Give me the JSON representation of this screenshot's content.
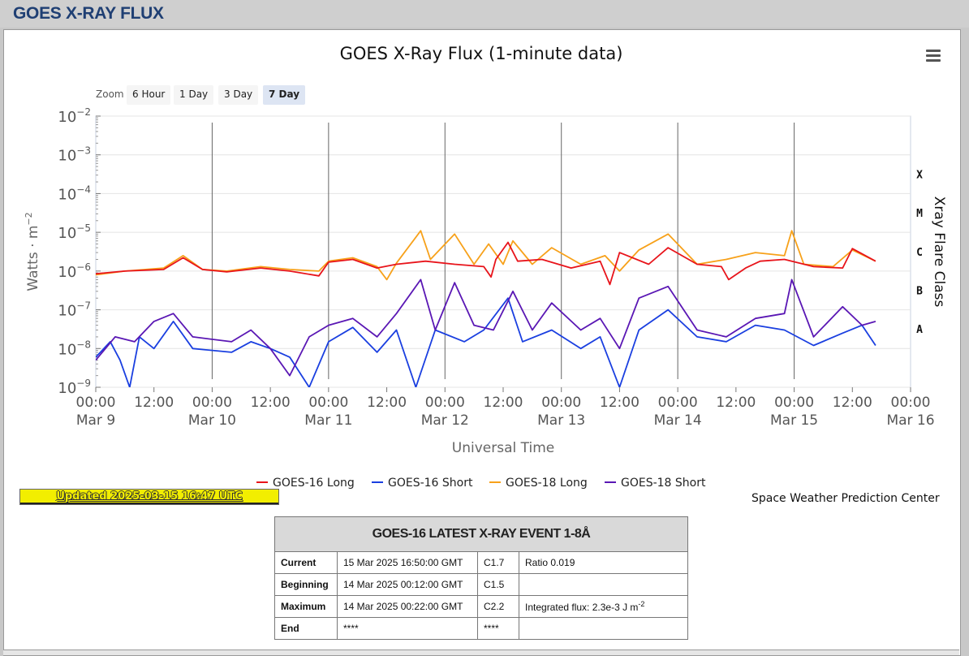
{
  "page": {
    "header_title": "GOES X-RAY FLUX"
  },
  "colors": {
    "goes16_long": "#e8141b",
    "goes16_short": "#1a3fe0",
    "goes18_long": "#f7a11a",
    "goes18_short": "#5a17b4",
    "header_text": "#1f3f73",
    "updated_bg": "#f2ee00"
  },
  "toolbar": {
    "zoom_label": "Zoom",
    "buttons": [
      "6 Hour",
      "1 Day",
      "3 Day",
      "7 Day"
    ],
    "active": "7 Day",
    "menu_icon": "hamburger-menu-icon"
  },
  "chart_data": {
    "type": "line",
    "title": "GOES X-Ray Flux (1-minute data)",
    "xlabel": "Universal Time",
    "ylabel": "Watts · m",
    "ylabel_exponent": "-2",
    "y2label": "Xray Flare Class",
    "y_scale": "log",
    "ylim": [
      1e-09,
      0.01
    ],
    "xlim": [
      "2025-03-09T00:00Z",
      "2025-03-16T00:00Z"
    ],
    "y_ticks": [
      {
        "base": "10",
        "exp": "-2",
        "value": 0.01
      },
      {
        "base": "10",
        "exp": "-3",
        "value": 0.001
      },
      {
        "base": "10",
        "exp": "-4",
        "value": 0.0001
      },
      {
        "base": "10",
        "exp": "-5",
        "value": 1e-05
      },
      {
        "base": "10",
        "exp": "-6",
        "value": 1e-06
      },
      {
        "base": "10",
        "exp": "-7",
        "value": 1e-07
      },
      {
        "base": "10",
        "exp": "-8",
        "value": 1e-08
      },
      {
        "base": "10",
        "exp": "-9",
        "value": 1e-09
      }
    ],
    "flare_classes": [
      {
        "label": "X",
        "value": 0.00032
      },
      {
        "label": "M",
        "value": 3.2e-05
      },
      {
        "label": "C",
        "value": 3.2e-06
      },
      {
        "label": "B",
        "value": 3.2e-07
      },
      {
        "label": "A",
        "value": 3.2e-08
      }
    ],
    "x_ticks": [
      {
        "line1": "00:00",
        "line2": "Mar 9",
        "value": "2025-03-09T00:00Z"
      },
      {
        "line1": "12:00",
        "line2": "",
        "value": "2025-03-09T12:00Z"
      },
      {
        "line1": "00:00",
        "line2": "Mar 10",
        "value": "2025-03-10T00:00Z"
      },
      {
        "line1": "12:00",
        "line2": "",
        "value": "2025-03-10T12:00Z"
      },
      {
        "line1": "00:00",
        "line2": "Mar 11",
        "value": "2025-03-11T00:00Z"
      },
      {
        "line1": "12:00",
        "line2": "",
        "value": "2025-03-11T12:00Z"
      },
      {
        "line1": "00:00",
        "line2": "Mar 12",
        "value": "2025-03-12T00:00Z"
      },
      {
        "line1": "12:00",
        "line2": "",
        "value": "2025-03-12T12:00Z"
      },
      {
        "line1": "00:00",
        "line2": "Mar 13",
        "value": "2025-03-13T00:00Z"
      },
      {
        "line1": "12:00",
        "line2": "",
        "value": "2025-03-13T12:00Z"
      },
      {
        "line1": "00:00",
        "line2": "Mar 14",
        "value": "2025-03-14T00:00Z"
      },
      {
        "line1": "12:00",
        "line2": "",
        "value": "2025-03-14T12:00Z"
      },
      {
        "line1": "00:00",
        "line2": "Mar 15",
        "value": "2025-03-15T00:00Z"
      },
      {
        "line1": "12:00",
        "line2": "",
        "value": "2025-03-15T12:00Z"
      },
      {
        "line1": "00:00",
        "line2": "Mar 16",
        "value": "2025-03-16T00:00Z"
      }
    ],
    "day_lines": [
      "2025-03-10T00:00Z",
      "2025-03-11T00:00Z",
      "2025-03-12T00:00Z",
      "2025-03-13T00:00Z",
      "2025-03-14T00:00Z",
      "2025-03-15T00:00Z"
    ],
    "legend_placement": "bottom",
    "series": [
      {
        "name": "GOES-16 Long",
        "color": "#e8141b",
        "points": [
          [
            "2025-03-09T00:00Z",
            8.5e-07
          ],
          [
            "2025-03-09T06:00Z",
            1e-06
          ],
          [
            "2025-03-09T14:00Z",
            1.1e-06
          ],
          [
            "2025-03-09T18:00Z",
            2.2e-06
          ],
          [
            "2025-03-09T22:00Z",
            1.1e-06
          ],
          [
            "2025-03-10T03:00Z",
            9.5e-07
          ],
          [
            "2025-03-10T10:00Z",
            1.2e-06
          ],
          [
            "2025-03-10T16:00Z",
            1e-06
          ],
          [
            "2025-03-10T22:00Z",
            7.5e-07
          ],
          [
            "2025-03-11T00:00Z",
            1.7e-06
          ],
          [
            "2025-03-11T05:00Z",
            2e-06
          ],
          [
            "2025-03-11T10:00Z",
            1.2e-06
          ],
          [
            "2025-03-11T14:00Z",
            1.5e-06
          ],
          [
            "2025-03-11T20:00Z",
            1.8e-06
          ],
          [
            "2025-03-12T02:00Z",
            1.5e-06
          ],
          [
            "2025-03-12T08:00Z",
            1.3e-06
          ],
          [
            "2025-03-12T09:30Z",
            7e-07
          ],
          [
            "2025-03-12T10:30Z",
            2e-06
          ],
          [
            "2025-03-12T13:00Z",
            5.5e-06
          ],
          [
            "2025-03-12T15:00Z",
            1.8e-06
          ],
          [
            "2025-03-12T20:00Z",
            2e-06
          ],
          [
            "2025-03-13T02:00Z",
            1.2e-06
          ],
          [
            "2025-03-13T08:00Z",
            1.8e-06
          ],
          [
            "2025-03-13T10:00Z",
            4.5e-07
          ],
          [
            "2025-03-13T12:00Z",
            3e-06
          ],
          [
            "2025-03-13T18:00Z",
            1.5e-06
          ],
          [
            "2025-03-13T22:00Z",
            4e-06
          ],
          [
            "2025-03-14T04:00Z",
            1.5e-06
          ],
          [
            "2025-03-14T09:00Z",
            1.3e-06
          ],
          [
            "2025-03-14T10:30Z",
            6e-07
          ],
          [
            "2025-03-14T14:00Z",
            1.2e-06
          ],
          [
            "2025-03-14T17:00Z",
            1.8e-06
          ],
          [
            "2025-03-14T22:00Z",
            2e-06
          ],
          [
            "2025-03-15T04:00Z",
            1.3e-06
          ],
          [
            "2025-03-15T10:00Z",
            1.2e-06
          ],
          [
            "2025-03-15T12:00Z",
            3.8e-06
          ],
          [
            "2025-03-15T16:47Z",
            1.8e-06
          ]
        ]
      },
      {
        "name": "GOES-16 Short",
        "color": "#1a3fe0",
        "points": [
          [
            "2025-03-09T00:00Z",
            6e-09
          ],
          [
            "2025-03-09T03:00Z",
            1.5e-08
          ],
          [
            "2025-03-09T05:00Z",
            5e-09
          ],
          [
            "2025-03-09T07:00Z",
            1e-09
          ],
          [
            "2025-03-09T09:00Z",
            2e-08
          ],
          [
            "2025-03-09T12:00Z",
            1e-08
          ],
          [
            "2025-03-09T16:00Z",
            5e-08
          ],
          [
            "2025-03-09T20:00Z",
            1e-08
          ],
          [
            "2025-03-10T04:00Z",
            8e-09
          ],
          [
            "2025-03-10T08:00Z",
            1.5e-08
          ],
          [
            "2025-03-10T12:00Z",
            1e-08
          ],
          [
            "2025-03-10T16:00Z",
            6e-09
          ],
          [
            "2025-03-10T20:00Z",
            1e-09
          ],
          [
            "2025-03-11T00:00Z",
            1.5e-08
          ],
          [
            "2025-03-11T05:00Z",
            3.5e-08
          ],
          [
            "2025-03-11T10:00Z",
            8e-09
          ],
          [
            "2025-03-11T14:00Z",
            3e-08
          ],
          [
            "2025-03-11T18:00Z",
            1e-09
          ],
          [
            "2025-03-11T22:00Z",
            3e-08
          ],
          [
            "2025-03-12T04:00Z",
            1.5e-08
          ],
          [
            "2025-03-12T08:00Z",
            3e-08
          ],
          [
            "2025-03-12T13:00Z",
            2e-07
          ],
          [
            "2025-03-12T16:00Z",
            1.5e-08
          ],
          [
            "2025-03-12T22:00Z",
            3e-08
          ],
          [
            "2025-03-13T04:00Z",
            1e-08
          ],
          [
            "2025-03-13T08:00Z",
            2e-08
          ],
          [
            "2025-03-13T12:00Z",
            1e-09
          ],
          [
            "2025-03-13T16:00Z",
            3e-08
          ],
          [
            "2025-03-13T22:00Z",
            1e-07
          ],
          [
            "2025-03-14T04:00Z",
            2e-08
          ],
          [
            "2025-03-14T10:00Z",
            1.5e-08
          ],
          [
            "2025-03-14T16:00Z",
            4e-08
          ],
          [
            "2025-03-14T22:00Z",
            3e-08
          ],
          [
            "2025-03-15T04:00Z",
            1.2e-08
          ],
          [
            "2025-03-15T10:00Z",
            2.5e-08
          ],
          [
            "2025-03-15T14:00Z",
            4e-08
          ],
          [
            "2025-03-15T16:47Z",
            1.2e-08
          ]
        ]
      },
      {
        "name": "GOES-18 Long",
        "color": "#f7a11a",
        "points": [
          [
            "2025-03-09T00:00Z",
            8e-07
          ],
          [
            "2025-03-09T06:00Z",
            1e-06
          ],
          [
            "2025-03-09T14:00Z",
            1.2e-06
          ],
          [
            "2025-03-09T18:00Z",
            2.5e-06
          ],
          [
            "2025-03-09T22:00Z",
            1.1e-06
          ],
          [
            "2025-03-10T03:00Z",
            1e-06
          ],
          [
            "2025-03-10T10:00Z",
            1.3e-06
          ],
          [
            "2025-03-10T16:00Z",
            1.1e-06
          ],
          [
            "2025-03-10T22:00Z",
            1e-06
          ],
          [
            "2025-03-11T00:00Z",
            1.8e-06
          ],
          [
            "2025-03-11T05:00Z",
            2.2e-06
          ],
          [
            "2025-03-11T10:00Z",
            1.3e-06
          ],
          [
            "2025-03-11T12:00Z",
            6e-07
          ],
          [
            "2025-03-11T14:00Z",
            1.6e-06
          ],
          [
            "2025-03-11T19:00Z",
            1.1e-05
          ],
          [
            "2025-03-11T21:00Z",
            2e-06
          ],
          [
            "2025-03-12T02:00Z",
            9e-06
          ],
          [
            "2025-03-12T06:00Z",
            1.5e-06
          ],
          [
            "2025-03-12T09:00Z",
            5e-06
          ],
          [
            "2025-03-12T12:00Z",
            1.5e-06
          ],
          [
            "2025-03-12T14:00Z",
            6e-06
          ],
          [
            "2025-03-12T18:00Z",
            1.5e-06
          ],
          [
            "2025-03-12T22:00Z",
            4e-06
          ],
          [
            "2025-03-13T04:00Z",
            1.5e-06
          ],
          [
            "2025-03-13T09:00Z",
            2.5e-06
          ],
          [
            "2025-03-13T12:00Z",
            1e-06
          ],
          [
            "2025-03-13T16:00Z",
            3.5e-06
          ],
          [
            "2025-03-13T22:00Z",
            9e-06
          ],
          [
            "2025-03-14T04:00Z",
            1.5e-06
          ],
          [
            "2025-03-14T10:00Z",
            2e-06
          ],
          [
            "2025-03-14T16:00Z",
            3e-06
          ],
          [
            "2025-03-14T22:00Z",
            2.5e-06
          ],
          [
            "2025-03-14T23:30Z",
            1.1e-05
          ],
          [
            "2025-03-15T02:00Z",
            1.5e-06
          ],
          [
            "2025-03-15T08:00Z",
            1.3e-06
          ],
          [
            "2025-03-15T12:00Z",
            3.5e-06
          ],
          [
            "2025-03-15T16:47Z",
            1.8e-06
          ]
        ]
      },
      {
        "name": "GOES-18 Short",
        "color": "#5a17b4",
        "points": [
          [
            "2025-03-09T00:00Z",
            5e-09
          ],
          [
            "2025-03-09T04:00Z",
            2e-08
          ],
          [
            "2025-03-09T08:00Z",
            1.5e-08
          ],
          [
            "2025-03-09T12:00Z",
            5e-08
          ],
          [
            "2025-03-09T16:00Z",
            8e-08
          ],
          [
            "2025-03-09T20:00Z",
            2e-08
          ],
          [
            "2025-03-10T04:00Z",
            1.5e-08
          ],
          [
            "2025-03-10T08:00Z",
            3e-08
          ],
          [
            "2025-03-10T12:00Z",
            1e-08
          ],
          [
            "2025-03-10T16:00Z",
            2e-09
          ],
          [
            "2025-03-10T20:00Z",
            2e-08
          ],
          [
            "2025-03-11T00:00Z",
            4e-08
          ],
          [
            "2025-03-11T05:00Z",
            6e-08
          ],
          [
            "2025-03-11T10:00Z",
            2e-08
          ],
          [
            "2025-03-11T14:00Z",
            8e-08
          ],
          [
            "2025-03-11T19:00Z",
            6e-07
          ],
          [
            "2025-03-11T22:00Z",
            3e-08
          ],
          [
            "2025-03-12T02:00Z",
            5e-07
          ],
          [
            "2025-03-12T06:00Z",
            4e-08
          ],
          [
            "2025-03-12T10:00Z",
            3e-08
          ],
          [
            "2025-03-12T14:00Z",
            3e-07
          ],
          [
            "2025-03-12T18:00Z",
            3e-08
          ],
          [
            "2025-03-12T22:00Z",
            1.5e-07
          ],
          [
            "2025-03-13T04:00Z",
            3e-08
          ],
          [
            "2025-03-13T08:00Z",
            6e-08
          ],
          [
            "2025-03-13T12:00Z",
            1e-08
          ],
          [
            "2025-03-13T16:00Z",
            2e-07
          ],
          [
            "2025-03-13T22:00Z",
            4e-07
          ],
          [
            "2025-03-14T04:00Z",
            3e-08
          ],
          [
            "2025-03-14T10:00Z",
            2e-08
          ],
          [
            "2025-03-14T16:00Z",
            6e-08
          ],
          [
            "2025-03-14T22:00Z",
            8e-08
          ],
          [
            "2025-03-14T23:30Z",
            6e-07
          ],
          [
            "2025-03-15T04:00Z",
            2e-08
          ],
          [
            "2025-03-15T10:00Z",
            1.2e-07
          ],
          [
            "2025-03-15T14:00Z",
            4e-08
          ],
          [
            "2025-03-15T16:47Z",
            5e-08
          ]
        ]
      }
    ]
  },
  "updated": "Updated 2025-03-15 16:47 UTC",
  "credit": "Space Weather Prediction Center",
  "event_table": {
    "title": "GOES-16 LATEST X-RAY EVENT 1-8Å",
    "rows": [
      {
        "label": "Current",
        "time": "15 Mar 2025 16:50:00 GMT",
        "class": "C1.7",
        "extra": "Ratio 0.019",
        "extra_sup": ""
      },
      {
        "label": "Beginning",
        "time": "14 Mar 2025 00:12:00 GMT",
        "class": "C1.5",
        "extra": "",
        "extra_sup": ""
      },
      {
        "label": "Maximum",
        "time": "14 Mar 2025 00:22:00 GMT",
        "class": "C2.2",
        "extra": "Integrated flux: 2.3e-3 J m",
        "extra_sup": "-2"
      },
      {
        "label": "End",
        "time": "****",
        "class": "****",
        "extra": "",
        "extra_sup": ""
      }
    ]
  }
}
